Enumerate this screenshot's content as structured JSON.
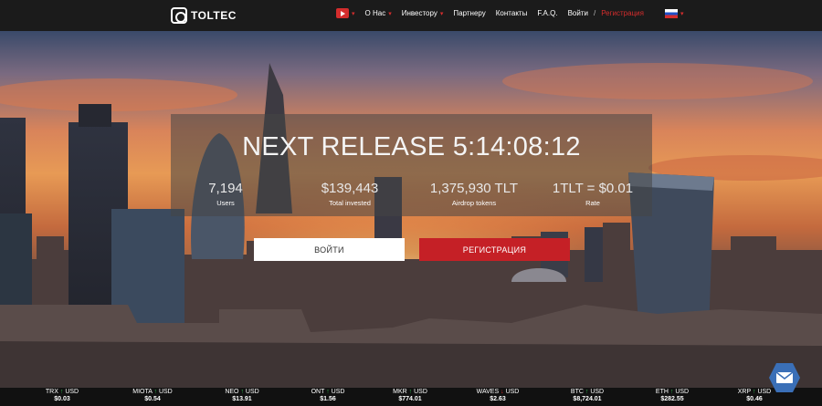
{
  "brand": {
    "name": "TOLTEC"
  },
  "nav": {
    "about": "О Нас",
    "investor": "Инвестору",
    "partner": "Партнеру",
    "contacts": "Контакты",
    "faq": "F.A.Q.",
    "login": "Войти",
    "separator": "/",
    "register": "Регистрация",
    "language_icon": "russian-flag-icon",
    "video_icon": "youtube-icon"
  },
  "hero": {
    "release": "NEXT RELEASE 5:14:08:12",
    "stats": [
      {
        "value": "7,194",
        "label": "Users"
      },
      {
        "value": "$139,443",
        "label": "Total invested"
      },
      {
        "value": "1,375,930 TLT",
        "label": "Airdrop tokens"
      },
      {
        "value": "1TLT = $0.01",
        "label": "Rate"
      }
    ],
    "login_button": "ВОЙТИ",
    "register_button": "РЕГИСТРАЦИЯ"
  },
  "ticker": [
    {
      "base": "TRX",
      "quote": "USD",
      "price": "$0.03",
      "direction": "up"
    },
    {
      "base": "MIOTA",
      "quote": "USD",
      "price": "$0.54",
      "direction": "up"
    },
    {
      "base": "NEO",
      "quote": "USD",
      "price": "$13.91",
      "direction": "up"
    },
    {
      "base": "ONT",
      "quote": "USD",
      "price": "$1.56",
      "direction": "up"
    },
    {
      "base": "MKR",
      "quote": "USD",
      "price": "$774.01",
      "direction": "up"
    },
    {
      "base": "WAVES",
      "quote": "USD",
      "price": "$2.63",
      "direction": "down"
    },
    {
      "base": "BTC",
      "quote": "USD",
      "price": "$8,724.01",
      "direction": "up"
    },
    {
      "base": "ETH",
      "quote": "USD",
      "price": "$282.55",
      "direction": "up"
    },
    {
      "base": "XRP",
      "quote": "USD",
      "price": "$0.46",
      "direction": "up"
    }
  ],
  "colors": {
    "accent": "#c52026",
    "up": "#2db84c",
    "down": "#d42d2d",
    "navbar": "#1b1b1b"
  }
}
